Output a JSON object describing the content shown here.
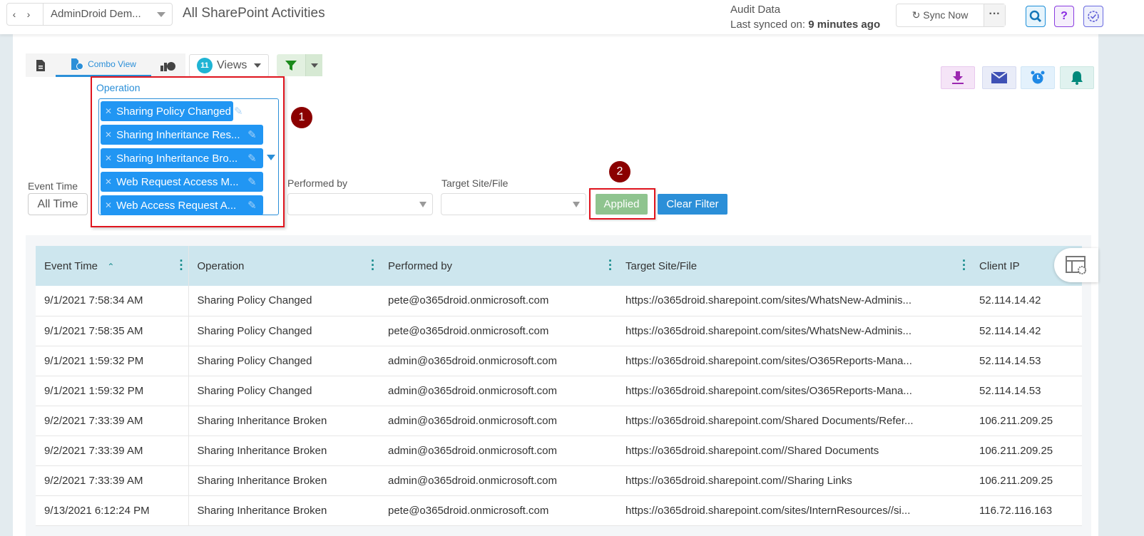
{
  "topbar": {
    "back": "‹",
    "forward": "›",
    "tenant": "AdminDroid Dem...",
    "title": "All SharePoint Activities",
    "audit_title": "Audit Data",
    "last_synced_label": "Last synced on:",
    "last_synced_value": "9 minutes ago",
    "sync_label": "Sync Now",
    "more": "···",
    "help": "?"
  },
  "toolbar": {
    "combo_view": "Combo View",
    "views_count": "11",
    "views_label": "Views"
  },
  "filters": {
    "operation_label": "Operation",
    "operation_chips": [
      "Sharing Policy Changed",
      "Sharing Inheritance Res...",
      "Sharing Inheritance Bro...",
      "Web Request Access M...",
      "Web Access Request A..."
    ],
    "event_time_label": "Event Time",
    "event_time_value": "All Time",
    "performed_by_label": "Performed by",
    "target_label": "Target Site/File",
    "applied_label": "Applied",
    "clear_label": "Clear Filter",
    "markers": [
      "1",
      "2"
    ]
  },
  "table": {
    "columns": [
      "Event Time",
      "Operation",
      "Performed by",
      "Target Site/File",
      "Client IP"
    ],
    "rows": [
      [
        "9/1/2021 7:58:34 AM",
        "Sharing Policy Changed",
        "pete@o365droid.onmicrosoft.com",
        "https://o365droid.sharepoint.com/sites/WhatsNew-Adminis...",
        "52.114.14.42"
      ],
      [
        "9/1/2021 7:58:35 AM",
        "Sharing Policy Changed",
        "pete@o365droid.onmicrosoft.com",
        "https://o365droid.sharepoint.com/sites/WhatsNew-Adminis...",
        "52.114.14.42"
      ],
      [
        "9/1/2021 1:59:32 PM",
        "Sharing Policy Changed",
        "admin@o365droid.onmicrosoft.com",
        "https://o365droid.sharepoint.com/sites/O365Reports-Mana...",
        "52.114.14.53"
      ],
      [
        "9/1/2021 1:59:32 PM",
        "Sharing Policy Changed",
        "admin@o365droid.onmicrosoft.com",
        "https://o365droid.sharepoint.com/sites/O365Reports-Mana...",
        "52.114.14.53"
      ],
      [
        "9/2/2021 7:33:39 AM",
        "Sharing Inheritance Broken",
        "admin@o365droid.onmicrosoft.com",
        "https://o365droid.sharepoint.com/Shared Documents/Refer...",
        "106.211.209.25"
      ],
      [
        "9/2/2021 7:33:39 AM",
        "Sharing Inheritance Broken",
        "admin@o365droid.onmicrosoft.com",
        "https://o365droid.sharepoint.com//Shared Documents",
        "106.211.209.25"
      ],
      [
        "9/2/2021 7:33:39 AM",
        "Sharing Inheritance Broken",
        "admin@o365droid.onmicrosoft.com",
        "https://o365droid.sharepoint.com//Sharing Links",
        "106.211.209.25"
      ],
      [
        "9/13/2021 6:12:24 PM",
        "Sharing Inheritance Broken",
        "pete@o365droid.onmicrosoft.com",
        "https://o365droid.sharepoint.com/sites/InternResources//si...",
        "116.72.116.163"
      ]
    ]
  }
}
